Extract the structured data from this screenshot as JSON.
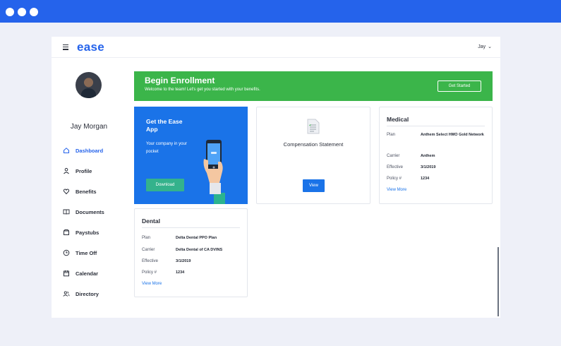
{
  "app": {
    "logo": "ease",
    "user_menu": "Jay",
    "user_name": "Jay Morgan"
  },
  "sidebar": {
    "items": [
      {
        "label": "Dashboard",
        "icon": "home-icon",
        "active": true
      },
      {
        "label": "Profile",
        "icon": "person-icon",
        "active": false
      },
      {
        "label": "Benefits",
        "icon": "heart-icon",
        "active": false
      },
      {
        "label": "Documents",
        "icon": "book-icon",
        "active": false
      },
      {
        "label": "Paystubs",
        "icon": "wallet-icon",
        "active": false
      },
      {
        "label": "Time Off",
        "icon": "clock-icon",
        "active": false
      },
      {
        "label": "Calendar",
        "icon": "calendar-icon",
        "active": false
      },
      {
        "label": "Directory",
        "icon": "people-icon",
        "active": false
      }
    ]
  },
  "banner": {
    "title": "Begin Enrollment",
    "subtitle": "Welcome to the team! Let's get you started with your benefits.",
    "button": "Get Started"
  },
  "app_card": {
    "title": "Get the Ease App",
    "subtitle": "Your company in your pocket",
    "button": "Download"
  },
  "compensation_card": {
    "label": "Compensation Statement",
    "button": "View"
  },
  "medical_card": {
    "title": "Medical",
    "rows": [
      {
        "label": "Plan",
        "value": "Anthem Select HMO Gold Network"
      },
      {
        "label": "Carrier",
        "value": "Anthem"
      },
      {
        "label": "Effective",
        "value": "3/1/2019"
      },
      {
        "label": "Policy #",
        "value": "1234"
      }
    ],
    "link": "View More"
  },
  "dental_card": {
    "title": "Dental",
    "rows": [
      {
        "label": "Plan",
        "value": "Delta Dental PPO Plan"
      },
      {
        "label": "Carrier",
        "value": "Delta Dental of CA DVINS"
      },
      {
        "label": "Effective",
        "value": "3/1/2019"
      },
      {
        "label": "Policy #",
        "value": "1234"
      }
    ],
    "link": "View More"
  },
  "colors": {
    "browser_bar": "#2563eb",
    "brand_blue": "#1a73e8",
    "enroll_green": "#3bb54a",
    "download_green": "#34b28c"
  }
}
